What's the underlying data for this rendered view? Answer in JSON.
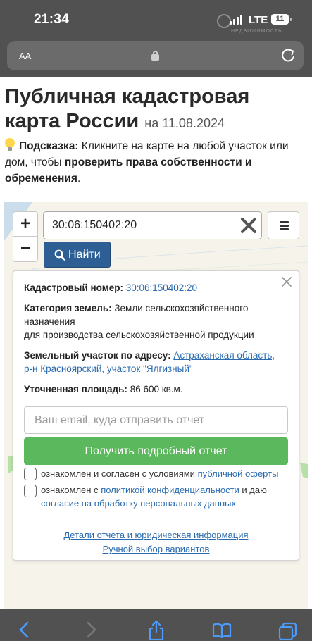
{
  "status_bar": {
    "time": "21:34",
    "network": "LTE",
    "battery": "11",
    "watermark_text": "НЕДВИЖИМОСТЬ"
  },
  "browser": {
    "text_size_label": "AA"
  },
  "page": {
    "title": "Публичная кадастровая карта России",
    "date": "на 11.08.2024",
    "hint_label": "Подсказка:",
    "hint_text": " Кликните на карте на любой участок или дом, чтобы ",
    "hint_bold": "проверить права собственности и обременения",
    "hint_end": "."
  },
  "map": {
    "zoom_in": "+",
    "zoom_out": "−",
    "search_value": "30:06:150402:20",
    "find_button": "Найти"
  },
  "panel": {
    "cadastral_label": "Кадастровый номер:",
    "cadastral_value": "30:06:150402:20",
    "category_label": "Категория земель:",
    "category_value_1": "Земли сельскохозяйственного назначения",
    "category_value_2": "для производства сельскохозяйственной продукции",
    "address_label": "Земельный участок по адресу:",
    "address_value_1": "Астраханская область,",
    "address_value_2": "р-н Красноярский, участок \"Ялгизный\"",
    "area_label": "Уточненная площадь:",
    "area_value": "86 600 кв.м.",
    "email_placeholder": "Ваш email, куда отправить отчет",
    "report_button": "Получить подробный отчет",
    "consent_1_text": "ознакомлен и согласен с условиями ",
    "consent_1_link": "публичной оферты",
    "consent_2_text": "ознакомлен с ",
    "consent_2_link_1": "политикой конфиденциальности",
    "consent_2_mid": " и даю",
    "consent_2_link_2": "согласие на обработку персональных данных",
    "details_link": "Детали отчета и юридическая информация",
    "manual_link": "Ручной выбор вариантов"
  },
  "colors": {
    "chrome": "#515151",
    "find_button": "#2e5f94",
    "report_button": "#5cb85c",
    "link": "#2a6bb0"
  }
}
